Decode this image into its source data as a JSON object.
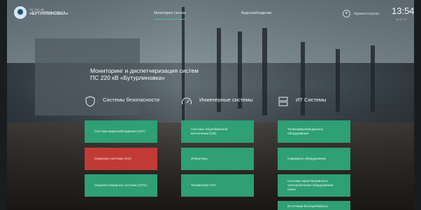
{
  "brand": {
    "org_line": "ПС 220 кВ",
    "name": "«БУТУРЛИНОВКА»"
  },
  "nav": {
    "monitoring": "Мониторинг систем",
    "video": "Видеонаблюдение"
  },
  "user": {
    "name": "Администратор"
  },
  "clock": {
    "time": "13:54",
    "date": "04.12.19"
  },
  "title": "Мониторинг и диспетчеризация систем ПС 220 кВ «Бутурлиновка»",
  "columns": [
    {
      "label": "Системы безопасности",
      "icon": "shield-icon",
      "buttons": [
        {
          "label": "Система видеонаблюдения (СОТ)",
          "status": "normal"
        },
        {
          "label": "Охранные системы (ОС)",
          "status": "alert"
        },
        {
          "label": "Охранно-пожарные системы (ОПС)",
          "status": "normal"
        }
      ]
    },
    {
      "label": "Инженерные системы",
      "icon": "gauge-icon",
      "buttons": [
        {
          "label": "Система общеобменной вентиляции (ОВ)",
          "status": "normal"
        },
        {
          "label": "Инверторы",
          "status": "normal"
        },
        {
          "label": "Телеметрия ПАК",
          "status": "normal"
        }
      ]
    },
    {
      "label": "ИТ Системы",
      "icon": "server-icon",
      "buttons": [
        {
          "label": "Телекоммуникационное оборудование",
          "status": "normal"
        },
        {
          "label": "Серверное оборудование",
          "status": "normal"
        },
        {
          "label": "Система гарантированного электропитания оборудования связи",
          "status": "normal"
        },
        {
          "label": "Источники бесперебойного",
          "status": "normal"
        }
      ]
    }
  ],
  "colors": {
    "normal": "#2f9f74",
    "alert": "#c23a35",
    "accent": "#4fbf9a"
  }
}
